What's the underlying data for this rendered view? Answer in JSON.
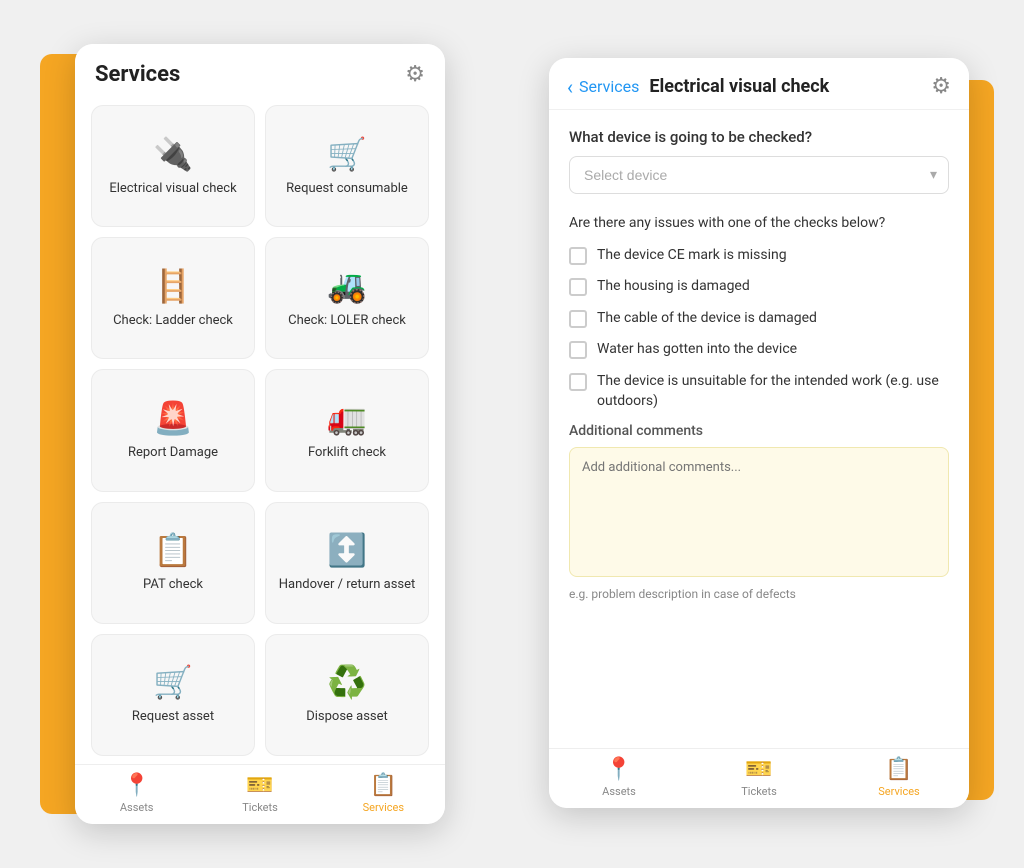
{
  "leftPhone": {
    "header": {
      "title": "Services",
      "gearLabel": "⚙"
    },
    "services": [
      {
        "id": "electrical",
        "icon": "🔌",
        "label": "Electrical visual\ncheck"
      },
      {
        "id": "consumable",
        "icon": "🛒",
        "label": "Request\nconsumable"
      },
      {
        "id": "ladder",
        "icon": "🪜",
        "label": "Check: Ladder\ncheck"
      },
      {
        "id": "loler",
        "icon": "🚜",
        "label": "Check: LOLER\ncheck"
      },
      {
        "id": "damage",
        "icon": "🚨",
        "label": "Report Damage"
      },
      {
        "id": "forklift",
        "icon": "🚛",
        "label": "Forklift check"
      },
      {
        "id": "pat",
        "icon": "📋",
        "label": "PAT check"
      },
      {
        "id": "handover",
        "icon": "↕",
        "label": "Handover / return\nasset"
      },
      {
        "id": "request-asset",
        "icon": "🛒",
        "label": "Request asset"
      },
      {
        "id": "dispose",
        "icon": "♻",
        "label": "Dispose asset"
      }
    ],
    "nav": [
      {
        "id": "assets",
        "icon": "📍",
        "label": "Assets",
        "active": false
      },
      {
        "id": "tickets",
        "icon": "🎫",
        "label": "Tickets",
        "active": false
      },
      {
        "id": "services",
        "icon": "📋",
        "label": "Services",
        "active": true
      }
    ]
  },
  "rightPhone": {
    "header": {
      "backLabel": "‹",
      "breadcrumb": "Services",
      "title": "Electrical visual check",
      "gearLabel": "⚙"
    },
    "deviceQuestion": "What device is going to be checked?",
    "deviceSelect": {
      "placeholder": "Select device",
      "options": [
        "Select device"
      ]
    },
    "checksQuestion": "Are there any issues with one of the checks below?",
    "checks": [
      {
        "id": "ce-mark",
        "label": "The device CE mark is missing"
      },
      {
        "id": "housing",
        "label": "The housing is damaged"
      },
      {
        "id": "cable",
        "label": "The cable of the device is damaged"
      },
      {
        "id": "water",
        "label": "Water has gotten into the device"
      },
      {
        "id": "unsuitable",
        "label": "The device is unsuitable for the intended work (e.g. use outdoors)"
      }
    ],
    "commentsLabel": "Additional comments",
    "commentsPlaceholder": "Add additional comments...",
    "commentsHint": "e.g. problem description in case of defects",
    "nav": [
      {
        "id": "assets",
        "icon": "📍",
        "label": "Assets",
        "active": false
      },
      {
        "id": "tickets",
        "icon": "🎫",
        "label": "Tickets",
        "active": false
      },
      {
        "id": "services",
        "icon": "📋",
        "label": "Services",
        "active": true
      }
    ]
  }
}
